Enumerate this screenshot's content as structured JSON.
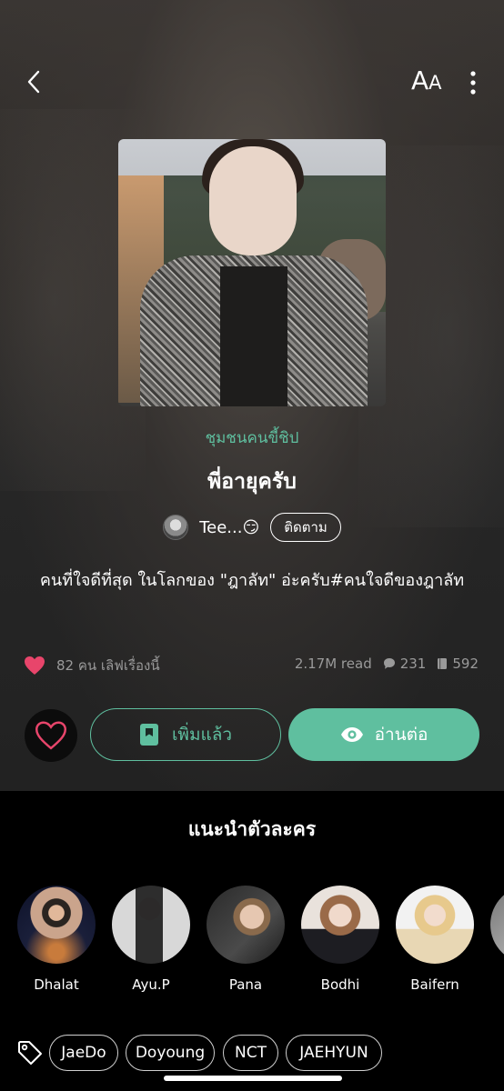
{
  "header": {
    "font_big": "A",
    "font_small": "A",
    "back_icon": "chevron-left-icon",
    "more_icon": "more-vertical-icon"
  },
  "story": {
    "category": "ชุมชนคนขี้ชิป",
    "title": "พี่อายุครับ",
    "author": "Tee...😏",
    "follow_label": "ติดตาม",
    "description": "คนที่ใจดีที่สุด ในโลกของ \"ฎาลัท\" อ่ะครับ#คนใจดีของฎาลัท"
  },
  "stats": {
    "love_text": "82 คน เลิฟเรื่องนี้",
    "reads": "2.17M read",
    "comments": "231",
    "chapters": "592"
  },
  "actions": {
    "added_label": "เพิ่มแล้ว",
    "read_label": "อ่านต่อ"
  },
  "characters": {
    "title": "แนะนำตัวละคร",
    "items": [
      {
        "name": "Dhalat"
      },
      {
        "name": "Ayu.P"
      },
      {
        "name": "Pana"
      },
      {
        "name": "Bodhi"
      },
      {
        "name": "Baifern"
      }
    ]
  },
  "tags": [
    "JaeDo",
    "Doyoung",
    "NCT",
    "JAEHYUN"
  ],
  "colors": {
    "accent": "#5fbf9f",
    "love": "#e8456b",
    "background": "#000000"
  }
}
